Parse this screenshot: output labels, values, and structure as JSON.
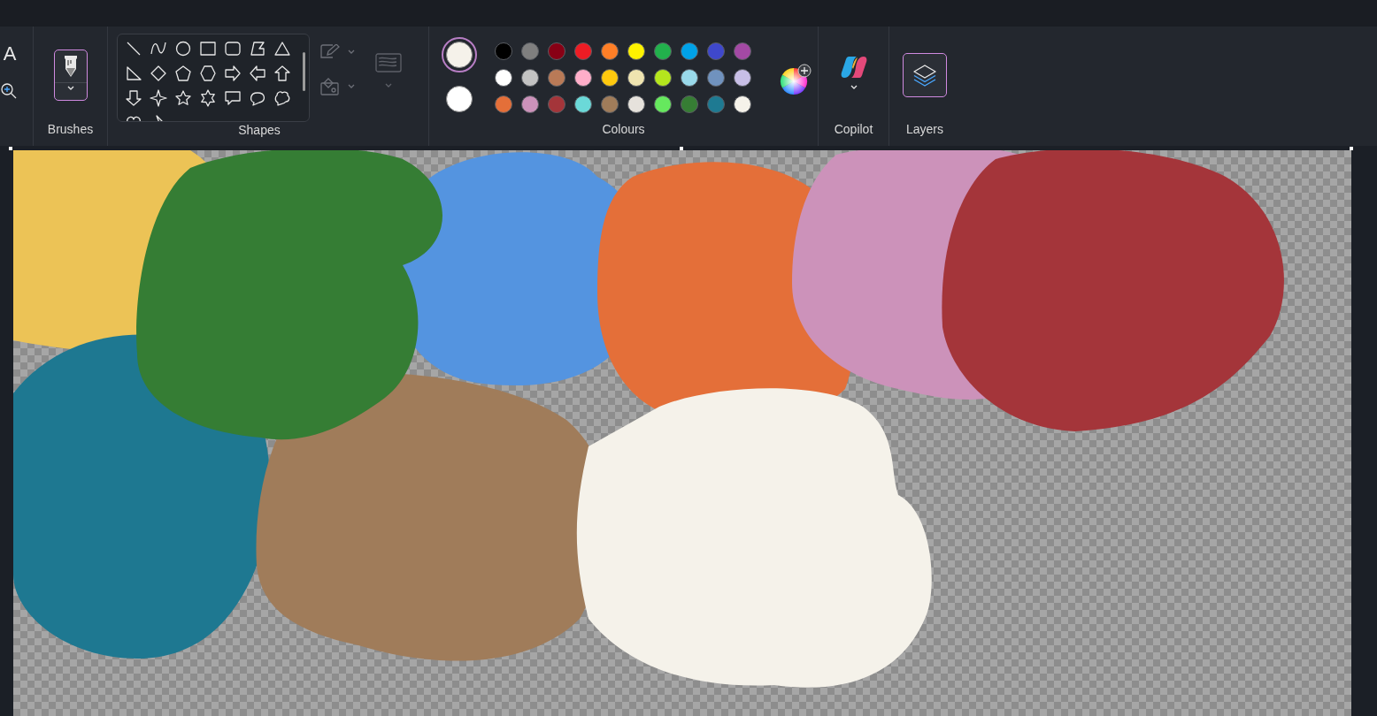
{
  "tools": {
    "text_tool_glyph": "A"
  },
  "brushes": {
    "label": "Brushes",
    "selected": true
  },
  "shapes": {
    "label": "Shapes"
  },
  "colours": {
    "label": "Colours",
    "primary": {
      "color": "#f5f2ea",
      "selected": true
    },
    "secondary": {
      "color": "#ffffff",
      "selected": false
    },
    "swatches": [
      {
        "color": "#000000"
      },
      {
        "color": "#7f7f7f"
      },
      {
        "color": "#880015"
      },
      {
        "color": "#ed1c24"
      },
      {
        "color": "#ff7f27"
      },
      {
        "color": "#fff200"
      },
      {
        "color": "#22b14c"
      },
      {
        "color": "#00a2e8"
      },
      {
        "color": "#3f48cc"
      },
      {
        "color": "#a349a4"
      },
      {
        "color": "#ffffff"
      },
      {
        "color": "#c3c3c3"
      },
      {
        "color": "#b97a57"
      },
      {
        "color": "#ffaec9"
      },
      {
        "color": "#ffc90e"
      },
      {
        "color": "#efe4b0"
      },
      {
        "color": "#b5e61d"
      },
      {
        "color": "#99d9ea"
      },
      {
        "color": "#7092be"
      },
      {
        "color": "#c8bfe7"
      },
      {
        "color": "#e46f39"
      },
      {
        "color": "#cc92ba"
      },
      {
        "color": "#a4353a"
      },
      {
        "color": "#6bd9d8"
      },
      {
        "color": "#a07c5a"
      },
      {
        "color": "#e6e2dc"
      },
      {
        "color": "#66e85e"
      },
      {
        "color": "#367d34"
      },
      {
        "color": "#1e7a92"
      },
      {
        "color": "#f5f2ea"
      }
    ]
  },
  "copilot": {
    "label": "Copilot"
  },
  "layers": {
    "label": "Layers",
    "selected": true
  }
}
